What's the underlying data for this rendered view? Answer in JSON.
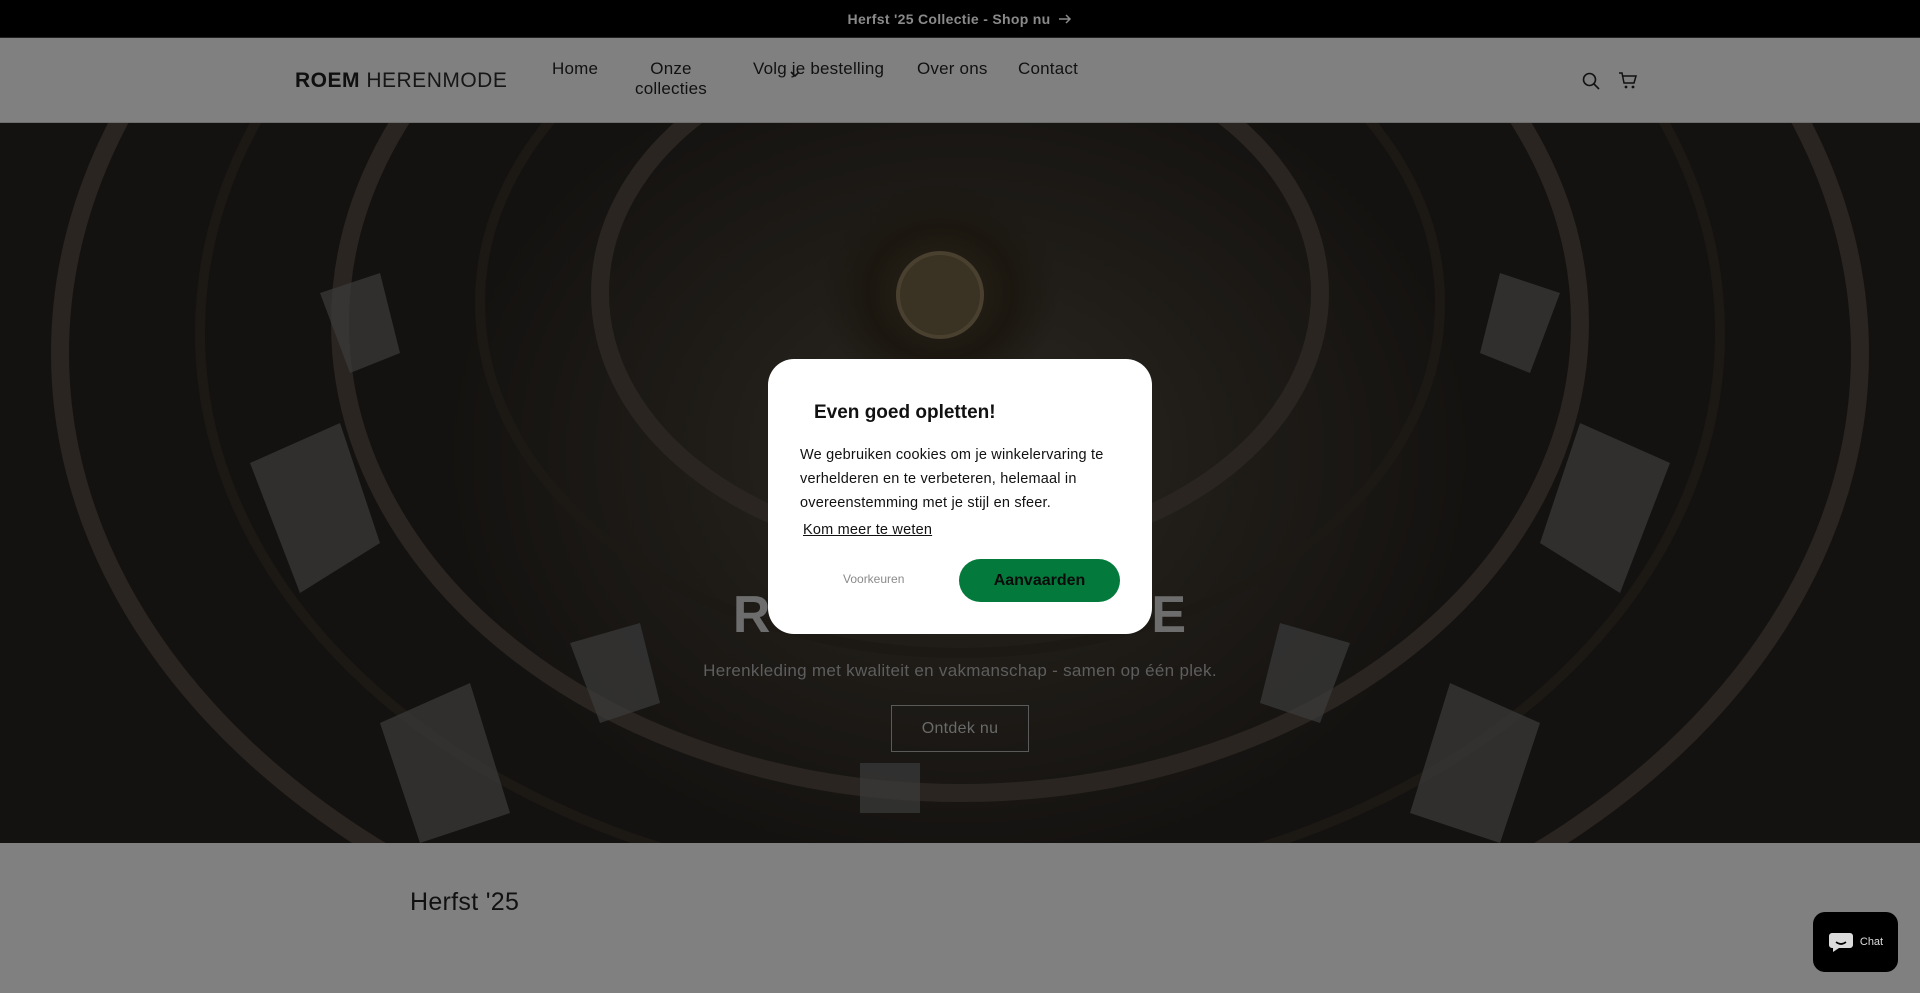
{
  "announcement": {
    "text": "Herfst '25 Collectie - Shop nu"
  },
  "header": {
    "logo_bold": "ROEM",
    "logo_light": "HERENMODE",
    "nav": {
      "home": "Home",
      "collections_line1": "Onze",
      "collections_line2": "collecties",
      "track": "Volg je bestelling",
      "about": "Over ons",
      "contact": "Contact"
    },
    "icons": [
      "search-icon",
      "cart-icon"
    ]
  },
  "hero": {
    "title_left": "RO",
    "title_right": "DE",
    "subtitle": "Herenkleding met kwaliteit en vakmanschap - samen op één plek.",
    "button": "Ontdek nu"
  },
  "section": {
    "title": "Herfst '25"
  },
  "chat": {
    "label": "Chat"
  },
  "cookie_modal": {
    "title": "Even goed opletten!",
    "body": "We gebruiken cookies om je winkelervaring te verhelderen en te verbeteren, helemaal in overeenstemming met je stijl en sfeer.",
    "link": "Kom meer te weten",
    "preferences_button": "Voorkeuren",
    "accept_button": "Aanvaarden",
    "accept_color": "#037a3c"
  },
  "colors": {
    "overlay": "#808080",
    "hero_dark": "#141210"
  }
}
